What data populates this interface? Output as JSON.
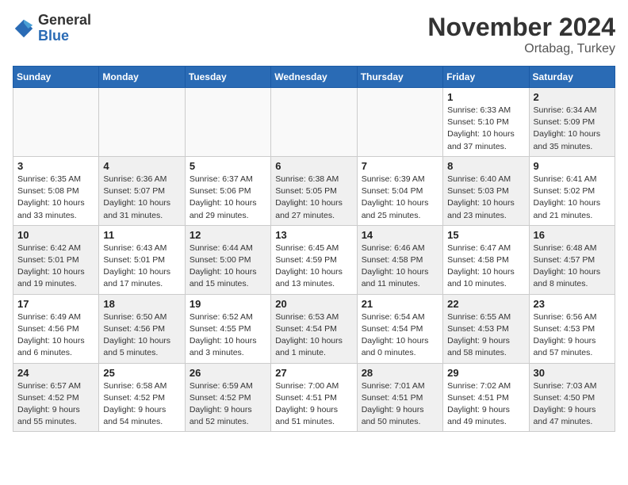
{
  "logo": {
    "general": "General",
    "blue": "Blue"
  },
  "title": "November 2024",
  "location": "Ortabag, Turkey",
  "days_header": [
    "Sunday",
    "Monday",
    "Tuesday",
    "Wednesday",
    "Thursday",
    "Friday",
    "Saturday"
  ],
  "weeks": [
    [
      {
        "num": "",
        "info": "",
        "empty": true
      },
      {
        "num": "",
        "info": "",
        "empty": true
      },
      {
        "num": "",
        "info": "",
        "empty": true
      },
      {
        "num": "",
        "info": "",
        "empty": true
      },
      {
        "num": "",
        "info": "",
        "empty": true
      },
      {
        "num": "1",
        "info": "Sunrise: 6:33 AM\nSunset: 5:10 PM\nDaylight: 10 hours and 37 minutes.",
        "empty": false
      },
      {
        "num": "2",
        "info": "Sunrise: 6:34 AM\nSunset: 5:09 PM\nDaylight: 10 hours and 35 minutes.",
        "empty": false
      }
    ],
    [
      {
        "num": "3",
        "info": "Sunrise: 6:35 AM\nSunset: 5:08 PM\nDaylight: 10 hours and 33 minutes.",
        "empty": false
      },
      {
        "num": "4",
        "info": "Sunrise: 6:36 AM\nSunset: 5:07 PM\nDaylight: 10 hours and 31 minutes.",
        "empty": false
      },
      {
        "num": "5",
        "info": "Sunrise: 6:37 AM\nSunset: 5:06 PM\nDaylight: 10 hours and 29 minutes.",
        "empty": false
      },
      {
        "num": "6",
        "info": "Sunrise: 6:38 AM\nSunset: 5:05 PM\nDaylight: 10 hours and 27 minutes.",
        "empty": false
      },
      {
        "num": "7",
        "info": "Sunrise: 6:39 AM\nSunset: 5:04 PM\nDaylight: 10 hours and 25 minutes.",
        "empty": false
      },
      {
        "num": "8",
        "info": "Sunrise: 6:40 AM\nSunset: 5:03 PM\nDaylight: 10 hours and 23 minutes.",
        "empty": false
      },
      {
        "num": "9",
        "info": "Sunrise: 6:41 AM\nSunset: 5:02 PM\nDaylight: 10 hours and 21 minutes.",
        "empty": false
      }
    ],
    [
      {
        "num": "10",
        "info": "Sunrise: 6:42 AM\nSunset: 5:01 PM\nDaylight: 10 hours and 19 minutes.",
        "empty": false
      },
      {
        "num": "11",
        "info": "Sunrise: 6:43 AM\nSunset: 5:01 PM\nDaylight: 10 hours and 17 minutes.",
        "empty": false
      },
      {
        "num": "12",
        "info": "Sunrise: 6:44 AM\nSunset: 5:00 PM\nDaylight: 10 hours and 15 minutes.",
        "empty": false
      },
      {
        "num": "13",
        "info": "Sunrise: 6:45 AM\nSunset: 4:59 PM\nDaylight: 10 hours and 13 minutes.",
        "empty": false
      },
      {
        "num": "14",
        "info": "Sunrise: 6:46 AM\nSunset: 4:58 PM\nDaylight: 10 hours and 11 minutes.",
        "empty": false
      },
      {
        "num": "15",
        "info": "Sunrise: 6:47 AM\nSunset: 4:58 PM\nDaylight: 10 hours and 10 minutes.",
        "empty": false
      },
      {
        "num": "16",
        "info": "Sunrise: 6:48 AM\nSunset: 4:57 PM\nDaylight: 10 hours and 8 minutes.",
        "empty": false
      }
    ],
    [
      {
        "num": "17",
        "info": "Sunrise: 6:49 AM\nSunset: 4:56 PM\nDaylight: 10 hours and 6 minutes.",
        "empty": false
      },
      {
        "num": "18",
        "info": "Sunrise: 6:50 AM\nSunset: 4:56 PM\nDaylight: 10 hours and 5 minutes.",
        "empty": false
      },
      {
        "num": "19",
        "info": "Sunrise: 6:52 AM\nSunset: 4:55 PM\nDaylight: 10 hours and 3 minutes.",
        "empty": false
      },
      {
        "num": "20",
        "info": "Sunrise: 6:53 AM\nSunset: 4:54 PM\nDaylight: 10 hours and 1 minute.",
        "empty": false
      },
      {
        "num": "21",
        "info": "Sunrise: 6:54 AM\nSunset: 4:54 PM\nDaylight: 10 hours and 0 minutes.",
        "empty": false
      },
      {
        "num": "22",
        "info": "Sunrise: 6:55 AM\nSunset: 4:53 PM\nDaylight: 9 hours and 58 minutes.",
        "empty": false
      },
      {
        "num": "23",
        "info": "Sunrise: 6:56 AM\nSunset: 4:53 PM\nDaylight: 9 hours and 57 minutes.",
        "empty": false
      }
    ],
    [
      {
        "num": "24",
        "info": "Sunrise: 6:57 AM\nSunset: 4:52 PM\nDaylight: 9 hours and 55 minutes.",
        "empty": false
      },
      {
        "num": "25",
        "info": "Sunrise: 6:58 AM\nSunset: 4:52 PM\nDaylight: 9 hours and 54 minutes.",
        "empty": false
      },
      {
        "num": "26",
        "info": "Sunrise: 6:59 AM\nSunset: 4:52 PM\nDaylight: 9 hours and 52 minutes.",
        "empty": false
      },
      {
        "num": "27",
        "info": "Sunrise: 7:00 AM\nSunset: 4:51 PM\nDaylight: 9 hours and 51 minutes.",
        "empty": false
      },
      {
        "num": "28",
        "info": "Sunrise: 7:01 AM\nSunset: 4:51 PM\nDaylight: 9 hours and 50 minutes.",
        "empty": false
      },
      {
        "num": "29",
        "info": "Sunrise: 7:02 AM\nSunset: 4:51 PM\nDaylight: 9 hours and 49 minutes.",
        "empty": false
      },
      {
        "num": "30",
        "info": "Sunrise: 7:03 AM\nSunset: 4:50 PM\nDaylight: 9 hours and 47 minutes.",
        "empty": false
      }
    ]
  ]
}
